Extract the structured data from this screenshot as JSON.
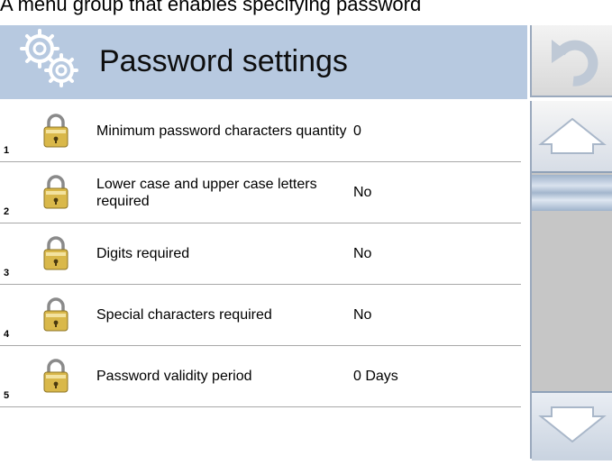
{
  "caption": "A menu group that enables specifying password",
  "header": {
    "title": "Password settings",
    "icon": "gears-icon"
  },
  "toolbar": {
    "back_icon": "undo-arrow-icon"
  },
  "rows": [
    {
      "number": "1",
      "label": "Minimum password characters quantity",
      "value": "0",
      "icon": "padlock-icon"
    },
    {
      "number": "2",
      "label": "Lower case and upper case letters required",
      "value": "No",
      "icon": "padlock-icon"
    },
    {
      "number": "3",
      "label": "Digits required",
      "value": "No",
      "icon": "padlock-icon"
    },
    {
      "number": "4",
      "label": "Special characters required",
      "value": "No",
      "icon": "padlock-icon"
    },
    {
      "number": "5",
      "label": "Password validity period",
      "value": "0 Days",
      "icon": "padlock-icon"
    }
  ],
  "scrollbar": {
    "up_icon": "arrow-up-icon",
    "down_icon": "arrow-down-icon"
  },
  "colors": {
    "header_bg": "#b7c9e0",
    "lock_gold": "#d9b84a",
    "scroll_track": "#c6c6c6"
  }
}
